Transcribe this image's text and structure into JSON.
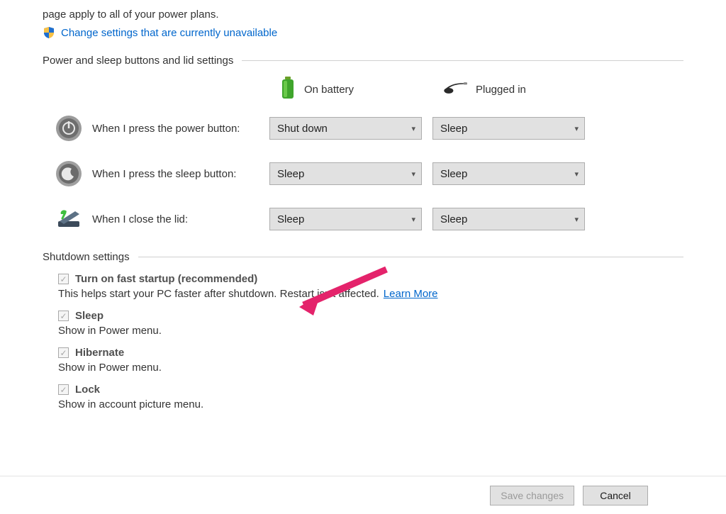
{
  "intro": "page apply to all of your power plans.",
  "admin_link": "Change settings that are currently unavailable",
  "section_buttons_lid": "Power and sleep buttons and lid settings",
  "col": {
    "battery": "On battery",
    "plugged": "Plugged in"
  },
  "rows": {
    "power": {
      "label": "When I press the power button:",
      "battery": "Shut down",
      "plugged": "Sleep"
    },
    "sleep": {
      "label": "When I press the sleep button:",
      "battery": "Sleep",
      "plugged": "Sleep"
    },
    "lid": {
      "label": "When I close the lid:",
      "battery": "Sleep",
      "plugged": "Sleep"
    }
  },
  "section_shutdown": "Shutdown settings",
  "shutdown": {
    "fast": {
      "title": "Turn on fast startup (recommended)",
      "desc": "This helps start your PC faster after shutdown. Restart isn't affected.",
      "learn": "Learn More"
    },
    "sleep": {
      "title": "Sleep",
      "desc": "Show in Power menu."
    },
    "hib": {
      "title": "Hibernate",
      "desc": "Show in Power menu."
    },
    "lock": {
      "title": "Lock",
      "desc": "Show in account picture menu."
    }
  },
  "buttons": {
    "save": "Save changes",
    "cancel": "Cancel"
  }
}
